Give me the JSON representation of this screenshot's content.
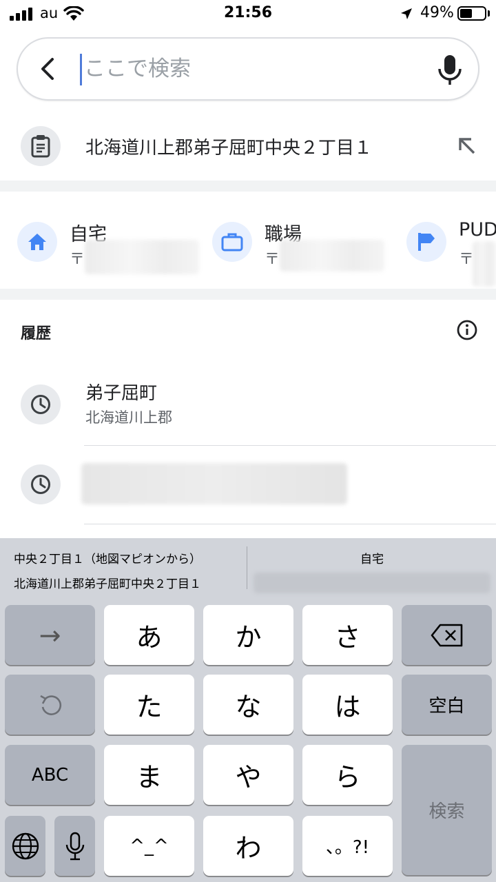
{
  "status_bar": {
    "carrier": "au",
    "time": "21:56",
    "battery_percent": "49%",
    "battery_level": 0.49
  },
  "search": {
    "placeholder": "ここで検索",
    "value": ""
  },
  "clipboard_suggestion": {
    "text": "北海道川上郡弟子屈町中央２丁目１",
    "icon": "clipboard-icon",
    "action_icon": "arrow-up-left-icon"
  },
  "shortcuts": [
    {
      "label": "自宅",
      "sub": "〒",
      "icon": "home-icon"
    },
    {
      "label": "職場",
      "sub": "〒",
      "icon": "briefcase-icon"
    },
    {
      "label": "PUD",
      "sub": "〒",
      "icon": "flag-icon"
    }
  ],
  "history": {
    "title": "履歴",
    "info_icon": "info-icon",
    "items": [
      {
        "title": "弟子屈町",
        "sub": "北海道川上郡",
        "icon": "clock-icon"
      },
      {
        "title": "",
        "sub": "",
        "icon": "clock-icon"
      }
    ]
  },
  "keyboard": {
    "predictions": {
      "left_line1": "中央２丁目１（地図マピオンから）",
      "left_line2": "北海道川上郡弟子屈町中央２丁目１",
      "right_title": "自宅"
    },
    "keys": {
      "arrow": "→",
      "a": "あ",
      "ka": "か",
      "sa": "さ",
      "ta": "た",
      "na": "な",
      "ha": "は",
      "space": "空白",
      "abc": "ABC",
      "ma": "ま",
      "ya": "や",
      "ra": "ら",
      "search": "検索",
      "emoticon": "^_^",
      "wa": "わ",
      "punct": "、。?!"
    }
  },
  "colors": {
    "accent": "#4285f4",
    "icon_bg_blue": "#e8f0fe",
    "icon_bg_gray": "#e8eaed",
    "keyboard_bg": "#d1d4da"
  }
}
